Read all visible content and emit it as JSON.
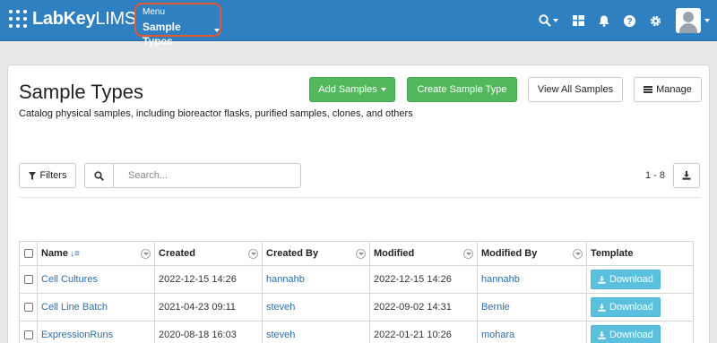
{
  "brand": {
    "name": "LabKey",
    "suffix": "LIMS"
  },
  "menu": {
    "label": "Menu",
    "value": "Sample Types"
  },
  "page": {
    "title": "Sample Types",
    "description": "Catalog physical samples, including bioreactor flasks, purified samples, clones, and others"
  },
  "actions": {
    "add_samples": "Add Samples",
    "create_sample_type": "Create Sample Type",
    "view_all_samples": "View All Samples",
    "manage": "Manage"
  },
  "toolbar": {
    "filters": "Filters",
    "search_placeholder": "Search...",
    "count": "1 - 8"
  },
  "table": {
    "columns": [
      "Name",
      "Created",
      "Created By",
      "Modified",
      "Modified By",
      "Template"
    ],
    "download_label": "Download",
    "rows": [
      {
        "name": "Cell Cultures",
        "created": "2022-12-15 14:26",
        "created_by": "hannahb",
        "modified": "2022-12-15 14:26",
        "modified_by": "hannahb"
      },
      {
        "name": "Cell Line Batch",
        "created": "2021-04-23 09:11",
        "created_by": "steveh",
        "modified": "2022-09-02 14:31",
        "modified_by": "Bernie"
      },
      {
        "name": "ExpressionRuns",
        "created": "2020-08-18 16:03",
        "created_by": "steveh",
        "modified": "2022-01-21 10:26",
        "modified_by": "mohara"
      }
    ]
  },
  "colors": {
    "nav": "#2f80c0",
    "green": "#53b85c",
    "info": "#5bc0de",
    "link": "#2e6eaa",
    "highlight": "#e5572f"
  },
  "icons": [
    "search-icon",
    "grid-icon",
    "bell-icon",
    "help-icon",
    "gear-icon",
    "user-avatar",
    "filter-icon",
    "download-icon",
    "sort-icon"
  ]
}
